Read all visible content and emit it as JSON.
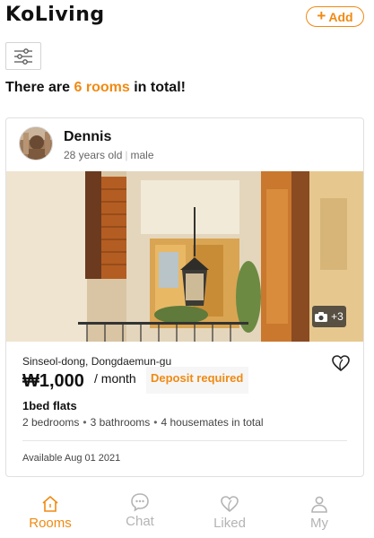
{
  "app": {
    "logo": "KoLiving",
    "add_label": "Add"
  },
  "summary": {
    "prefix": "There are",
    "count_text": "6 rooms",
    "suffix": "in total!"
  },
  "listing": {
    "host_name": "Dennis",
    "host_age": "28 years old",
    "host_gender": "male",
    "photo_extra": "+3",
    "address": "Sinseol-dong, Dongdaemun-gu",
    "price": "₩1,000",
    "per": "/ month",
    "deposit": "Deposit required",
    "flat_type": "1bed flats",
    "details": [
      "2 bedrooms",
      "3 bathrooms",
      "4 housemates in total"
    ],
    "available": "Available Aug 01 2021"
  },
  "tabs": [
    {
      "label": "Rooms",
      "icon": "home-icon",
      "active": true
    },
    {
      "label": "Chat",
      "icon": "chat-bubble-icon",
      "active": false
    },
    {
      "label": "Liked",
      "icon": "heart-icon",
      "active": false
    },
    {
      "label": "My",
      "icon": "person-icon",
      "active": false
    }
  ],
  "colors": {
    "accent": "#f08a12",
    "inactive_tab": "#b4b4b4"
  }
}
